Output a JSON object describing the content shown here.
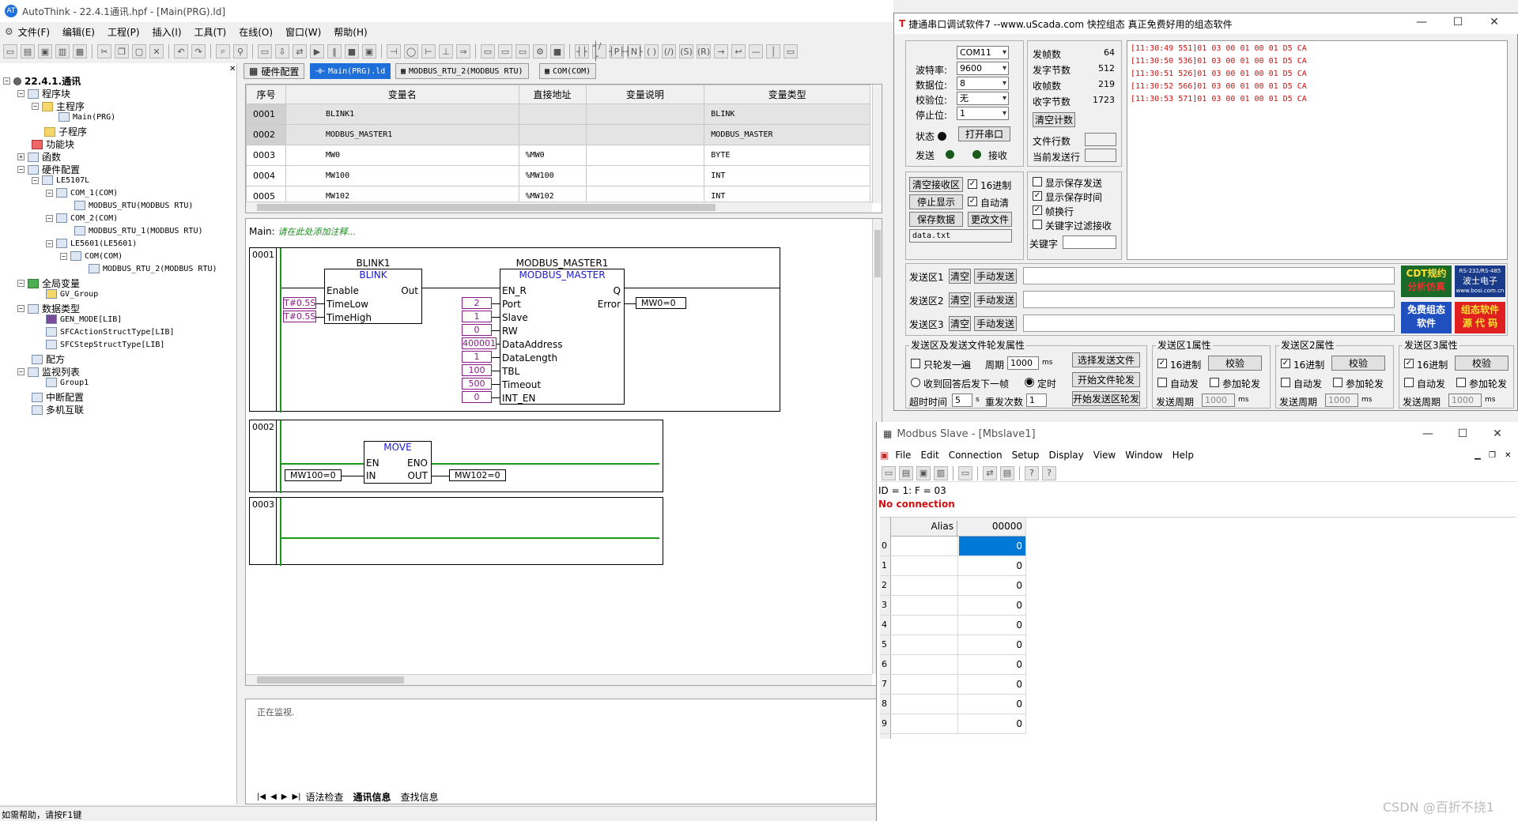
{
  "app": {
    "title": "AutoThink - 22.4.1通讯.hpf - [Main(PRG).ld]",
    "menu": [
      "文件(F)",
      "编辑(E)",
      "工程(P)",
      "插入(I)",
      "工具(T)",
      "在线(O)",
      "窗口(W)",
      "帮助(H)"
    ],
    "status_help": "如需帮助，请按F1键"
  },
  "tree": {
    "root": "22.4.1.通讯",
    "items": [
      "程序块",
      "主程序",
      "Main(PRG)",
      "子程序",
      "功能块",
      "函数",
      "硬件配置",
      "LE5107L",
      "COM_1(COM)",
      "MODBUS_RTU(MODBUS RTU)",
      "COM_2(COM)",
      "MODBUS_RTU_1(MODBUS RTU)",
      "LE5601(LE5601)",
      "COM(COM)",
      "MODBUS_RTU_2(MODBUS RTU)",
      "全局变量",
      "GV_Group",
      "数据类型",
      "GEN_MODE[LIB]",
      "SFCActionStructType[LIB]",
      "SFCStepStructType[LIB]",
      "配方",
      "监视列表",
      "Group1",
      "中断配置",
      "多机互联"
    ]
  },
  "tabs": [
    "硬件配置",
    "Main(PRG).ld",
    "MODBUS_RTU_2(MODBUS RTU)",
    "COM(COM)"
  ],
  "var_table": {
    "headers": [
      "序号",
      "变量名",
      "直接地址",
      "变量说明",
      "变量类型"
    ],
    "rows": [
      [
        "0001",
        "BLINK1",
        "",
        "",
        "BLINK"
      ],
      [
        "0002",
        "MODBUS_MASTER1",
        "",
        "",
        "MODBUS_MASTER"
      ],
      [
        "0003",
        "MW0",
        "%MW0",
        "",
        "BYTE"
      ],
      [
        "0004",
        "MW100",
        "%MW100",
        "",
        "INT"
      ],
      [
        "0005",
        "MW102",
        "%MW102",
        "",
        "INT"
      ]
    ]
  },
  "ld": {
    "main_label": "Main:",
    "comment": "请在此处添加注释...",
    "rung1": {
      "num": "0001",
      "blink_inst": "BLINK1",
      "blink_type": "BLINK",
      "blink_pins_in": [
        "Enable",
        "TimeLow",
        "TimeHigh"
      ],
      "blink_pin_out": "Out",
      "blink_vals": [
        "T#0.5S",
        "T#0.5S"
      ],
      "mm_inst": "MODBUS_MASTER1",
      "mm_type": "MODBUS_MASTER",
      "mm_pins_in": [
        "EN_R",
        "Port",
        "Slave",
        "RW",
        "DataAddress",
        "DataLength",
        "TBL",
        "Timeout",
        "INT_EN"
      ],
      "mm_pins_out": [
        "Q",
        "Error"
      ],
      "mm_vals": [
        "2",
        "1",
        "0",
        "400001",
        "1",
        "100",
        "500",
        "0"
      ],
      "mm_error_out": "MW0=0"
    },
    "rung2": {
      "num": "0002",
      "block": "MOVE",
      "pins_in": [
        "EN",
        "IN"
      ],
      "pins_out": [
        "ENO",
        "OUT"
      ],
      "in_val": "MW100=0",
      "out_val": "MW102=0"
    },
    "rung3": {
      "num": "0003"
    }
  },
  "output": {
    "text": "正在监视.",
    "tabs": [
      "语法检查",
      "通讯信息",
      "查找信息"
    ]
  },
  "serial": {
    "title": "捷通串口调试软件7  --www.uScada.com  快控组态  真正免费好用的组态软件",
    "port_labels": [
      "波特率:",
      "数据位:",
      "校验位:",
      "停止位:"
    ],
    "port": "COM11",
    "baud": "9600",
    "databits": "8",
    "parity": "无",
    "stopbits": "1",
    "state_label": "状态",
    "open_btn": "打开串口",
    "send_label": "发送",
    "recv_label": "接收",
    "stats_labels": [
      "发帧数",
      "发字节数",
      "收帧数",
      "收字节数"
    ],
    "stats_values": [
      "64",
      "512",
      "219",
      "1723"
    ],
    "clear_count_btn": "清空计数",
    "file_lines_label": "文件行数",
    "cur_line_label": "当前发送行",
    "log": [
      "[11:30:49 551]01 03 00 01 00 01 D5 CA",
      "[11:30:50 536]01 03 00 01 00 01 D5 CA",
      "[11:30:51 526]01 03 00 01 00 01 D5 CA",
      "[11:30:52 566]01 03 00 01 00 01 D5 CA",
      "[11:30:53 571]01 03 00 01 00 01 D5 CA"
    ],
    "btns_left": [
      "清空接收区",
      "停止显示",
      "保存数据",
      "更改文件"
    ],
    "chk_hex": "16进制",
    "chk_autoclear": "自动清",
    "file_name": "data.txt",
    "opts": [
      "显示保存发送",
      "显示保存时间",
      "帧换行",
      "关键字过滤接收"
    ],
    "keyword_label": "关键字",
    "send_zones": [
      "发送区1",
      "发送区2",
      "发送区3"
    ],
    "clear_btn": "清空",
    "manual_btn": "手动发送",
    "ad1": [
      "CDT规约",
      "分析仿真"
    ],
    "ad2": [
      "RS-232/RS-485",
      "波士电子",
      "www.bosi.com.cn"
    ],
    "ad3": [
      "免费组态",
      "软件"
    ],
    "ad4": [
      "组态软件",
      "源 代 码"
    ],
    "props_title": "发送区及发送文件轮发属性",
    "only_once": "只轮发一遍",
    "period_label": "周期",
    "period": "1000",
    "ms": "ms",
    "select_file_btn": "选择发送文件",
    "reply_next": "收到回答后发下一帧",
    "timed": "定时",
    "start_file_btn": "开始文件轮发",
    "timeout_label": "超时时间",
    "timeout": "5",
    "s": "s",
    "retry_label": "重发次数",
    "retry": "1",
    "start_zone_btn": "开始发送区轮发",
    "zone_props": [
      "发送区1属性",
      "发送区2属性",
      "发送区3属性"
    ],
    "verify_btn": "校验",
    "auto_send": "自动发",
    "join_poll": "参加轮发",
    "send_period_label": "发送周期",
    "send_period": "1000"
  },
  "mbslave": {
    "title": "Modbus Slave - [Mbslave1]",
    "menu": [
      "File",
      "Edit",
      "Connection",
      "Setup",
      "Display",
      "View",
      "Window",
      "Help"
    ],
    "id_line": "ID = 1: F = 03",
    "status": "No connection",
    "col_alias": "Alias",
    "col_addr": "00000",
    "rows": [
      "0",
      "1",
      "2",
      "3",
      "4",
      "5",
      "6",
      "7",
      "8",
      "9"
    ],
    "values": [
      "0",
      "0",
      "0",
      "0",
      "0",
      "0",
      "0",
      "0",
      "0",
      "0"
    ]
  },
  "watermark": "CSDN @百折不挠1"
}
